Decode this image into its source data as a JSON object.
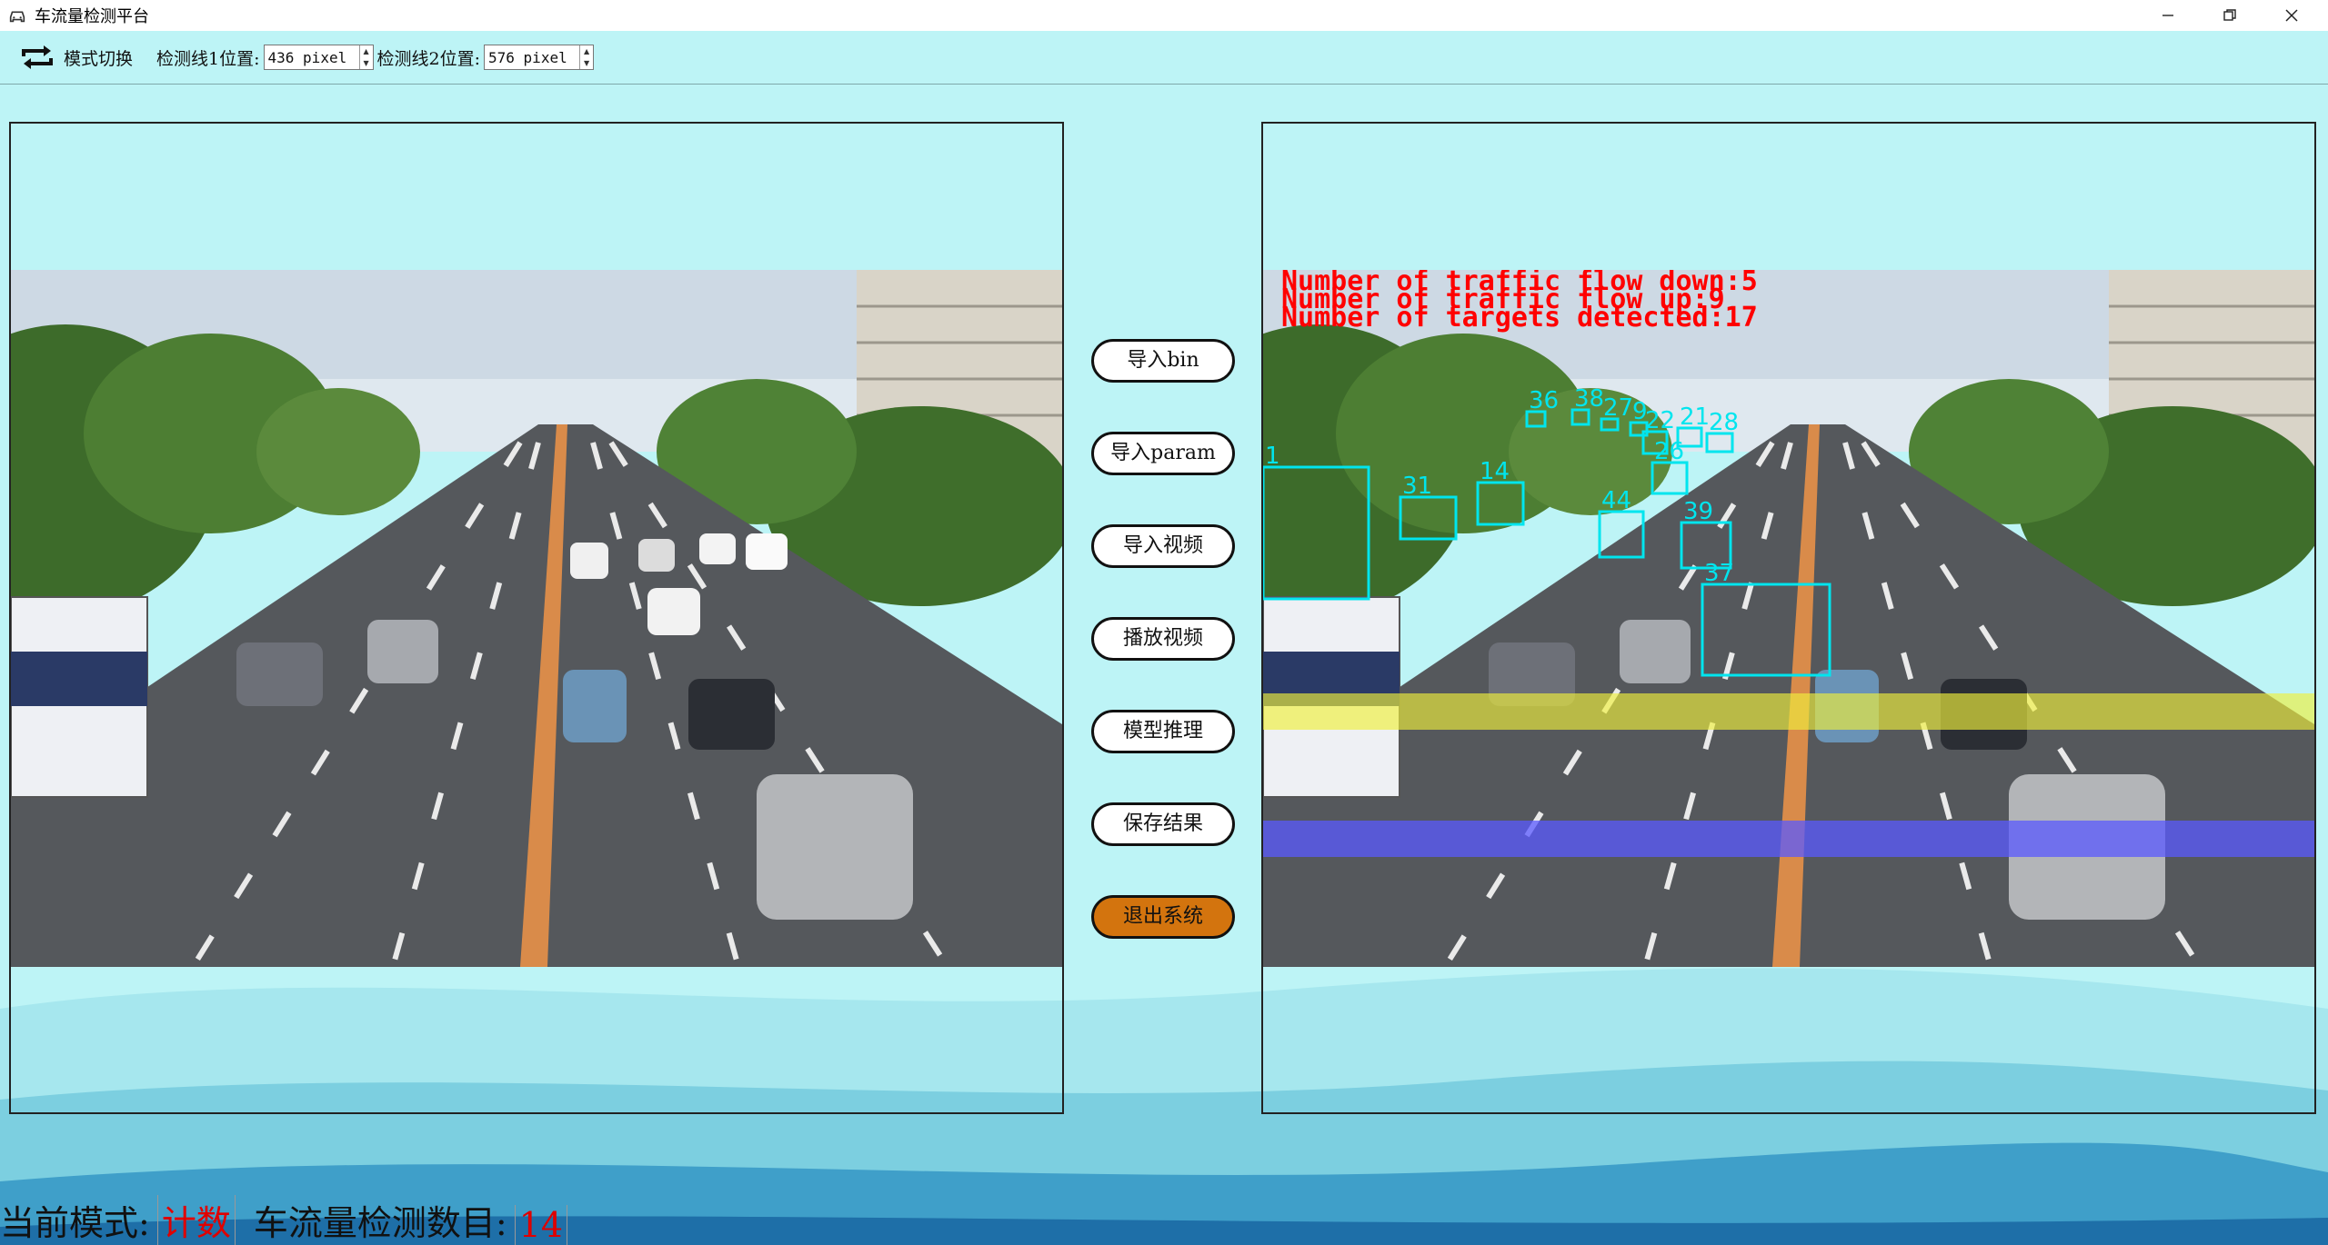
{
  "window": {
    "title": "车流量检测平台",
    "controls": [
      "minimize-icon",
      "restore-icon",
      "close-icon"
    ]
  },
  "toolbar": {
    "mode_switch_label": "模式切换",
    "line1_label": "检测线1位置:",
    "line1_value": "436 pixel",
    "line2_label": "检测线2位置:",
    "line2_value": "576 pixel"
  },
  "buttons": {
    "import_bin": "导入bin",
    "import_param": "导入param",
    "import_video": "导入视频",
    "play_video": "播放视频",
    "model_infer": "模型推理",
    "save_result": "保存结果",
    "exit": "退出系统"
  },
  "overlay": {
    "line_down": "Number of traffic flow down:5",
    "line_up": "Number of traffic flow up:9",
    "line_targets": "Number of targets detected:17"
  },
  "detections": [
    "1",
    "31",
    "14",
    "44",
    "39",
    "37",
    "36",
    "38",
    "27",
    "9",
    "22",
    "21",
    "28",
    "26"
  ],
  "footer": {
    "mode_label": "当前模式:",
    "mode_value": "计数",
    "count_label": "车流量检测数目:",
    "count_value": "14"
  },
  "colors": {
    "background": "#bdf4f6",
    "exit_button": "#d3740e",
    "overlay_text": "#ff0000",
    "box": "#00e5ee",
    "line_yellow": "#f0f03c",
    "line_blue": "#5a5aff"
  }
}
